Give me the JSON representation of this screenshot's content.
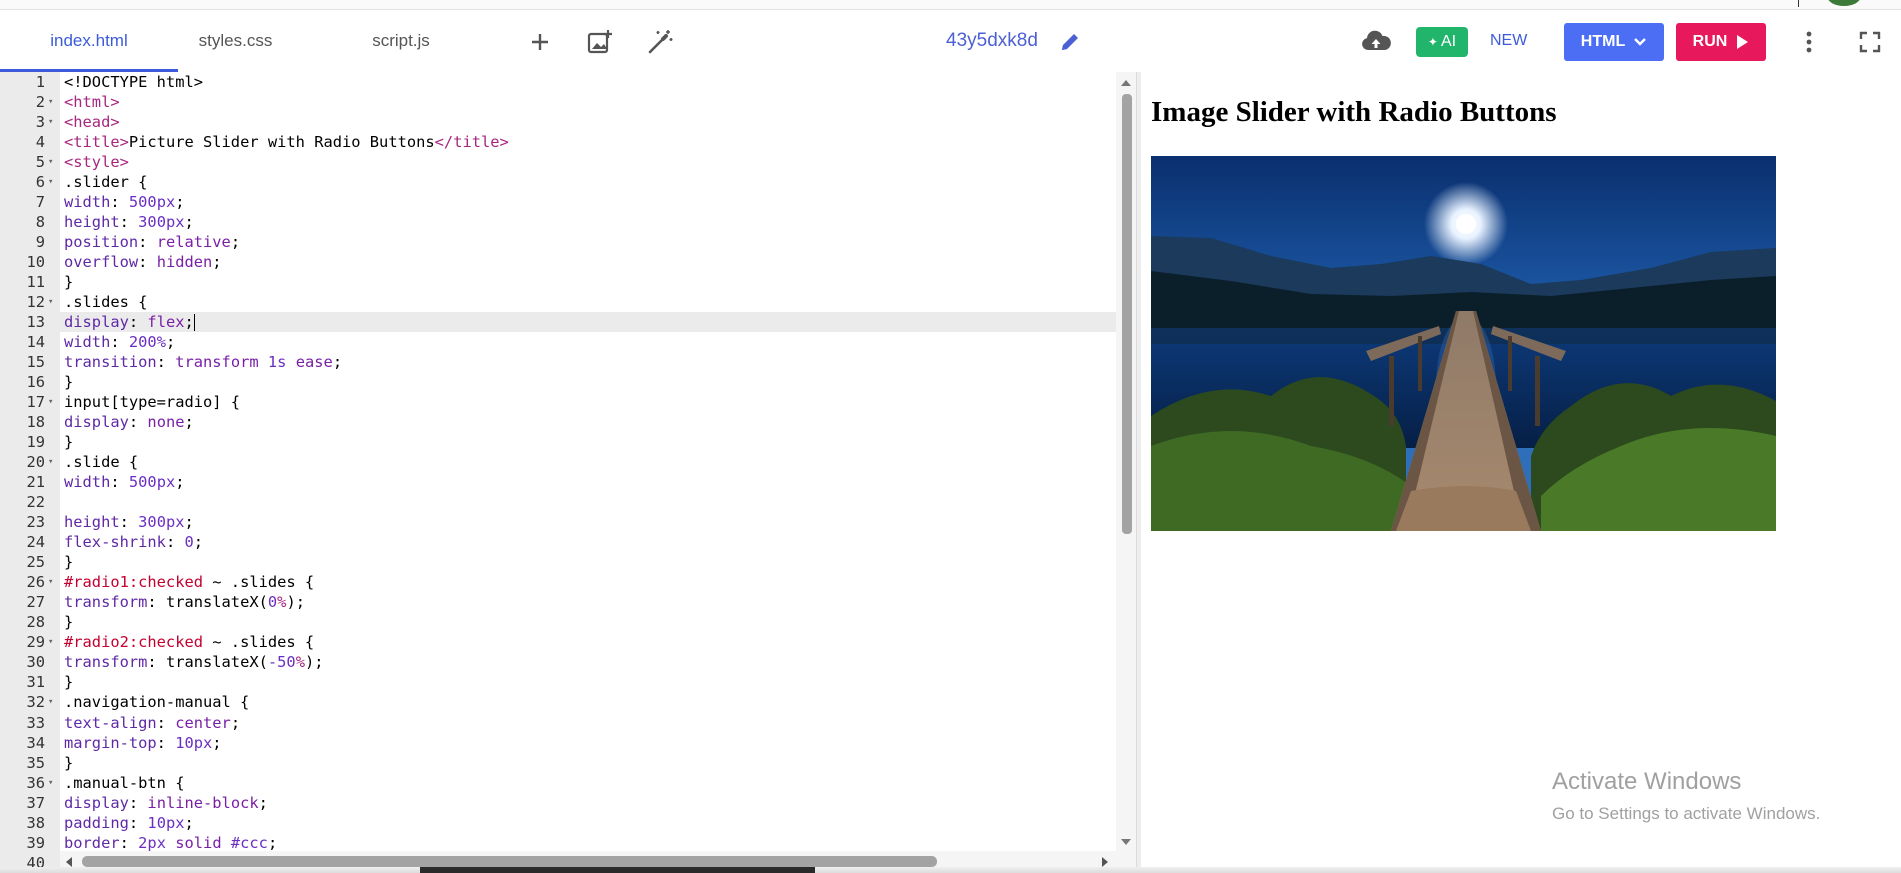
{
  "toolbar": {
    "tabs": [
      {
        "label": "index.html",
        "active": true
      },
      {
        "label": "styles.css",
        "active": false
      },
      {
        "label": "script.js",
        "active": false
      }
    ],
    "tool_icons": [
      "plus-icon",
      "add-image-icon",
      "magic-wand-icon"
    ],
    "project_name": "43y5dxk8d",
    "ai_label": "AI",
    "new_label": "NEW",
    "language_label": "HTML",
    "run_label": "RUN",
    "colors": {
      "accent": "#3b5bdb",
      "ai_green": "#20b56b",
      "html_blue": "#4c6ef5",
      "run_pink": "#e8185d"
    }
  },
  "editor": {
    "active_line": 13,
    "lines": [
      {
        "n": "1",
        "fold": false,
        "tokens": [
          [
            "t-txt",
            "<!DOCTYPE html>"
          ]
        ]
      },
      {
        "n": "2",
        "fold": true,
        "tokens": [
          [
            "t-tag",
            "<html>"
          ]
        ]
      },
      {
        "n": "3",
        "fold": true,
        "tokens": [
          [
            "t-tag",
            "<head>"
          ]
        ]
      },
      {
        "n": "4",
        "fold": false,
        "tokens": [
          [
            "t-tag",
            "<title>"
          ],
          [
            "t-txt",
            "Picture Slider with Radio Buttons"
          ],
          [
            "t-tag",
            "</title>"
          ]
        ]
      },
      {
        "n": "5",
        "fold": true,
        "tokens": [
          [
            "t-tag",
            "<style>"
          ]
        ]
      },
      {
        "n": "6",
        "fold": true,
        "tokens": [
          [
            "t-sel",
            ".slider {"
          ]
        ]
      },
      {
        "n": "7",
        "fold": false,
        "tokens": [
          [
            "t-prop",
            "width"
          ],
          [
            "t-txt",
            ": "
          ],
          [
            "t-num",
            "500px"
          ],
          [
            "t-txt",
            ";"
          ]
        ]
      },
      {
        "n": "8",
        "fold": false,
        "tokens": [
          [
            "t-prop",
            "height"
          ],
          [
            "t-txt",
            ": "
          ],
          [
            "t-num",
            "300px"
          ],
          [
            "t-txt",
            ";"
          ]
        ]
      },
      {
        "n": "9",
        "fold": false,
        "tokens": [
          [
            "t-prop",
            "position"
          ],
          [
            "t-txt",
            ": "
          ],
          [
            "t-kw",
            "relative"
          ],
          [
            "t-txt",
            ";"
          ]
        ]
      },
      {
        "n": "10",
        "fold": false,
        "tokens": [
          [
            "t-prop",
            "overflow"
          ],
          [
            "t-txt",
            ": "
          ],
          [
            "t-kw",
            "hidden"
          ],
          [
            "t-txt",
            ";"
          ]
        ]
      },
      {
        "n": "11",
        "fold": false,
        "tokens": [
          [
            "t-txt",
            "}"
          ]
        ]
      },
      {
        "n": "12",
        "fold": true,
        "tokens": [
          [
            "t-sel",
            ".slides {"
          ]
        ]
      },
      {
        "n": "13",
        "fold": false,
        "tokens": [
          [
            "t-prop",
            "display"
          ],
          [
            "t-txt",
            ": "
          ],
          [
            "t-kw",
            "flex"
          ],
          [
            "t-txt",
            ";"
          ]
        ],
        "cursor": true
      },
      {
        "n": "14",
        "fold": false,
        "tokens": [
          [
            "t-prop",
            "width"
          ],
          [
            "t-txt",
            ": "
          ],
          [
            "t-num",
            "200%"
          ],
          [
            "t-txt",
            ";"
          ]
        ]
      },
      {
        "n": "15",
        "fold": false,
        "tokens": [
          [
            "t-prop",
            "transition"
          ],
          [
            "t-txt",
            ": "
          ],
          [
            "t-kw",
            "transform"
          ],
          [
            "t-txt",
            " "
          ],
          [
            "t-num",
            "1s"
          ],
          [
            "t-txt",
            " "
          ],
          [
            "t-kw",
            "ease"
          ],
          [
            "t-txt",
            ";"
          ]
        ]
      },
      {
        "n": "16",
        "fold": false,
        "tokens": [
          [
            "t-txt",
            "}"
          ]
        ]
      },
      {
        "n": "17",
        "fold": true,
        "tokens": [
          [
            "t-sel",
            "input[type=radio] {"
          ]
        ]
      },
      {
        "n": "18",
        "fold": false,
        "tokens": [
          [
            "t-prop",
            "display"
          ],
          [
            "t-txt",
            ": "
          ],
          [
            "t-kw",
            "none"
          ],
          [
            "t-txt",
            ";"
          ]
        ]
      },
      {
        "n": "19",
        "fold": false,
        "tokens": [
          [
            "t-txt",
            "}"
          ]
        ]
      },
      {
        "n": "20",
        "fold": true,
        "tokens": [
          [
            "t-sel",
            ".slide {"
          ]
        ]
      },
      {
        "n": "21",
        "fold": false,
        "tokens": [
          [
            "t-prop",
            "width"
          ],
          [
            "t-txt",
            ": "
          ],
          [
            "t-num",
            "500px"
          ],
          [
            "t-txt",
            ";"
          ]
        ]
      },
      {
        "n": "22",
        "fold": false,
        "tokens": []
      },
      {
        "n": "23",
        "fold": false,
        "tokens": [
          [
            "t-prop",
            "height"
          ],
          [
            "t-txt",
            ": "
          ],
          [
            "t-num",
            "300px"
          ],
          [
            "t-txt",
            ";"
          ]
        ]
      },
      {
        "n": "24",
        "fold": false,
        "tokens": [
          [
            "t-prop",
            "flex-shrink"
          ],
          [
            "t-txt",
            ": "
          ],
          [
            "t-num",
            "0"
          ],
          [
            "t-txt",
            ";"
          ]
        ]
      },
      {
        "n": "25",
        "fold": false,
        "tokens": [
          [
            "t-txt",
            "}"
          ]
        ]
      },
      {
        "n": "26",
        "fold": true,
        "tokens": [
          [
            "t-id",
            "#radio1:checked"
          ],
          [
            "t-txt",
            " ~ .slides {"
          ]
        ]
      },
      {
        "n": "27",
        "fold": false,
        "tokens": [
          [
            "t-prop",
            "transform"
          ],
          [
            "t-txt",
            ": translateX("
          ],
          [
            "t-num",
            "0"
          ],
          [
            "t-pct",
            "%"
          ],
          [
            "t-txt",
            ");"
          ]
        ]
      },
      {
        "n": "28",
        "fold": false,
        "tokens": [
          [
            "t-txt",
            "}"
          ]
        ]
      },
      {
        "n": "29",
        "fold": true,
        "tokens": [
          [
            "t-id",
            "#radio2:checked"
          ],
          [
            "t-txt",
            " ~ .slides {"
          ]
        ]
      },
      {
        "n": "30",
        "fold": false,
        "tokens": [
          [
            "t-prop",
            "transform"
          ],
          [
            "t-txt",
            ": translateX("
          ],
          [
            "t-num",
            "-50"
          ],
          [
            "t-pct",
            "%"
          ],
          [
            "t-txt",
            ");"
          ]
        ]
      },
      {
        "n": "31",
        "fold": false,
        "tokens": [
          [
            "t-txt",
            "}"
          ]
        ]
      },
      {
        "n": "32",
        "fold": true,
        "tokens": [
          [
            "t-sel",
            ".navigation-manual {"
          ]
        ]
      },
      {
        "n": "33",
        "fold": false,
        "tokens": [
          [
            "t-prop",
            "text-align"
          ],
          [
            "t-txt",
            ": "
          ],
          [
            "t-kw",
            "center"
          ],
          [
            "t-txt",
            ";"
          ]
        ]
      },
      {
        "n": "34",
        "fold": false,
        "tokens": [
          [
            "t-prop",
            "margin-top"
          ],
          [
            "t-txt",
            ": "
          ],
          [
            "t-num",
            "10px"
          ],
          [
            "t-txt",
            ";"
          ]
        ]
      },
      {
        "n": "35",
        "fold": false,
        "tokens": [
          [
            "t-txt",
            "}"
          ]
        ]
      },
      {
        "n": "36",
        "fold": true,
        "tokens": [
          [
            "t-sel",
            ".manual-btn {"
          ]
        ]
      },
      {
        "n": "37",
        "fold": false,
        "tokens": [
          [
            "t-prop",
            "display"
          ],
          [
            "t-txt",
            ": "
          ],
          [
            "t-kw",
            "inline-block"
          ],
          [
            "t-txt",
            ";"
          ]
        ]
      },
      {
        "n": "38",
        "fold": false,
        "tokens": [
          [
            "t-prop",
            "padding"
          ],
          [
            "t-txt",
            ": "
          ],
          [
            "t-num",
            "10px"
          ],
          [
            "t-txt",
            ";"
          ]
        ]
      },
      {
        "n": "39",
        "fold": false,
        "tokens": [
          [
            "t-prop",
            "border"
          ],
          [
            "t-txt",
            ": "
          ],
          [
            "t-num",
            "2px"
          ],
          [
            "t-txt",
            " "
          ],
          [
            "t-kw",
            "solid"
          ],
          [
            "t-txt",
            " "
          ],
          [
            "t-num",
            "#ccc"
          ],
          [
            "t-txt",
            ";"
          ]
        ]
      },
      {
        "n": "40",
        "fold": false,
        "tokens": []
      }
    ]
  },
  "preview": {
    "heading": "Image Slider with Radio Buttons",
    "image": "night-lake-dock-photo"
  },
  "watermark": {
    "line1": "Activate Windows",
    "line2": "Go to Settings to activate Windows."
  }
}
